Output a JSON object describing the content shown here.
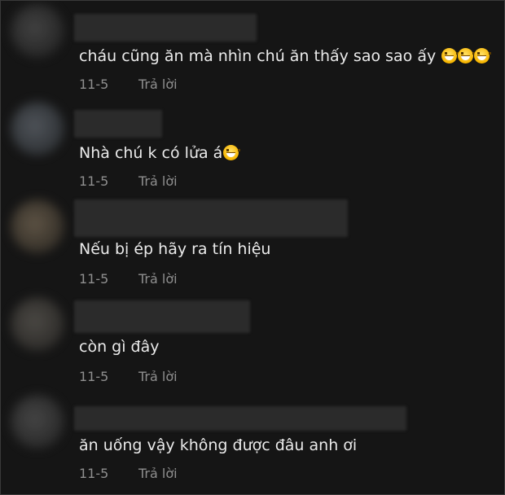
{
  "comments": [
    {
      "text": "cháu cũng ăn mà nhìn chú ăn thấy sao sao ấy",
      "emojis": [
        "grinning-sweat-emoji",
        "grinning-sweat-emoji",
        "grinning-sweat-emoji"
      ],
      "date": "11-5",
      "reply_label": "Trả lời"
    },
    {
      "text": "Nhà chú k có lửa á",
      "emojis": [
        "grinning-emoji"
      ],
      "date": "11-5",
      "reply_label": "Trả lời"
    },
    {
      "text": "Nếu bị ép hãy ra tín hiệu",
      "emojis": [],
      "date": "11-5",
      "reply_label": "Trả lời"
    },
    {
      "text": "còn gì đây",
      "emojis": [],
      "date": "11-5",
      "reply_label": "Trả lời"
    },
    {
      "text": "ăn uống vậy không được đâu anh ơi",
      "emojis": [],
      "date": "11-5",
      "reply_label": "Trả lời"
    }
  ],
  "colors": {
    "background": "#151515",
    "text": "#eaeaea",
    "meta": "#8f8f8f"
  }
}
